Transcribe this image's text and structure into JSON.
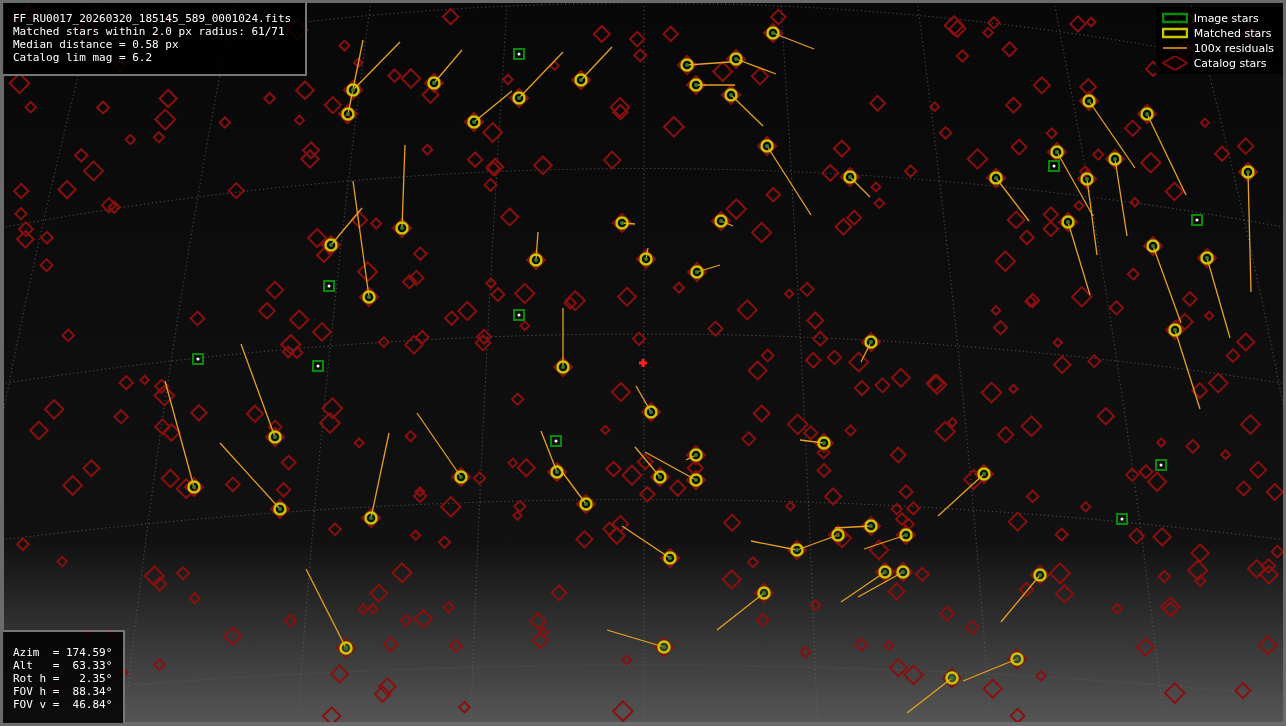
{
  "info_box": {
    "lines": [
      "FF_RU0017_20260320_185145_589_0001024.fits",
      "Matched stars within 2.0 px radius: 61/71",
      "Median distance = 0.58 px",
      "Catalog lim mag = 6.2"
    ]
  },
  "legend": [
    {
      "kind": "image",
      "label": "Image stars"
    },
    {
      "kind": "matched",
      "label": "Matched stars"
    },
    {
      "kind": "residual",
      "label": "100x residuals"
    },
    {
      "kind": "catalog",
      "label": "Catalog stars"
    }
  ],
  "pointing_box": {
    "lines": [
      "Azim  = 174.59°",
      "Alt   =  63.33°",
      "Rot h =   2.35°",
      "FOV h =  88.34°",
      "FOV v =  46.84°"
    ]
  }
}
